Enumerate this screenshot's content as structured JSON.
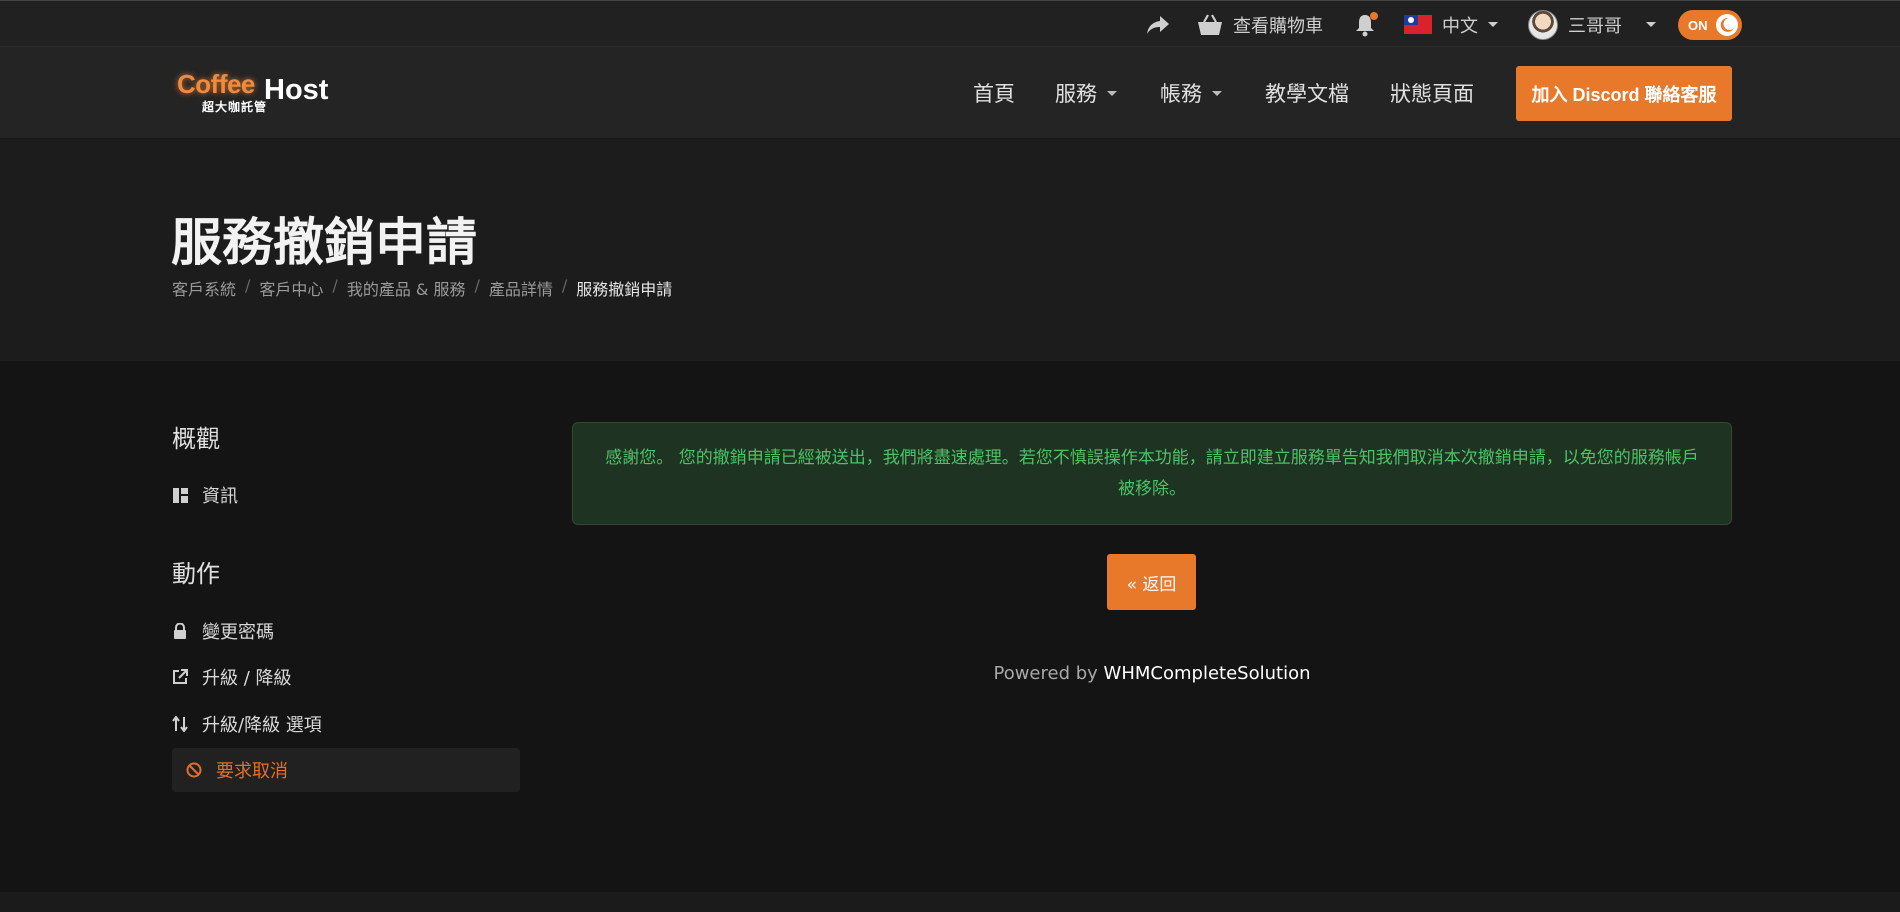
{
  "topbar": {
    "cart_label": "查看購物車",
    "language_label": "中文",
    "username": "三哥哥",
    "theme_toggle_label": "ON"
  },
  "logo": {
    "brand_main": "Coffee",
    "brand_host": "Host",
    "brand_sub": "超大咖託管"
  },
  "nav": {
    "home": "首頁",
    "services": "服務",
    "billing": "帳務",
    "docs": "教學文檔",
    "status": "狀態頁面",
    "discord_button": "加入 Discord 聯絡客服"
  },
  "page": {
    "title": "服務撤銷申請",
    "breadcrumb": [
      "客戶系統",
      "客戶中心",
      "我的產品 & 服務",
      "產品詳情",
      "服務撤銷申請"
    ]
  },
  "sidebar": {
    "overview_heading": "概觀",
    "info_label": "資訊",
    "actions_heading": "動作",
    "change_password": "變更密碼",
    "upgrade_downgrade": "升級 / 降級",
    "upgrade_options": "升級/降級 選項",
    "request_cancel": "要求取消"
  },
  "main": {
    "alert_text": "感謝您。 您的撤銷申請已經被送出，我們將盡速處理。若您不慎誤操作本功能，請立即建立服務單告知我們取消本次撤銷申請，以免您的服務帳戶被移除。",
    "back_button": "« 返回",
    "powered_prefix": "Powered by",
    "powered_brand": "WHMCompleteSolution"
  },
  "colors": {
    "accent": "#e8782a",
    "background": "#141414",
    "success_text": "#4cc266",
    "success_bg": "#1f3322"
  },
  "icons": {
    "share": "share-icon",
    "cart": "basket-icon",
    "bell": "bell-icon",
    "flag": "taiwan-flag-icon",
    "avatar": "avatar",
    "info": "dashboard-icon",
    "lock": "lock-icon",
    "external": "external-link-icon",
    "sort": "arrows-updown-icon",
    "ban": "ban-icon",
    "moon": "moon-icon"
  }
}
